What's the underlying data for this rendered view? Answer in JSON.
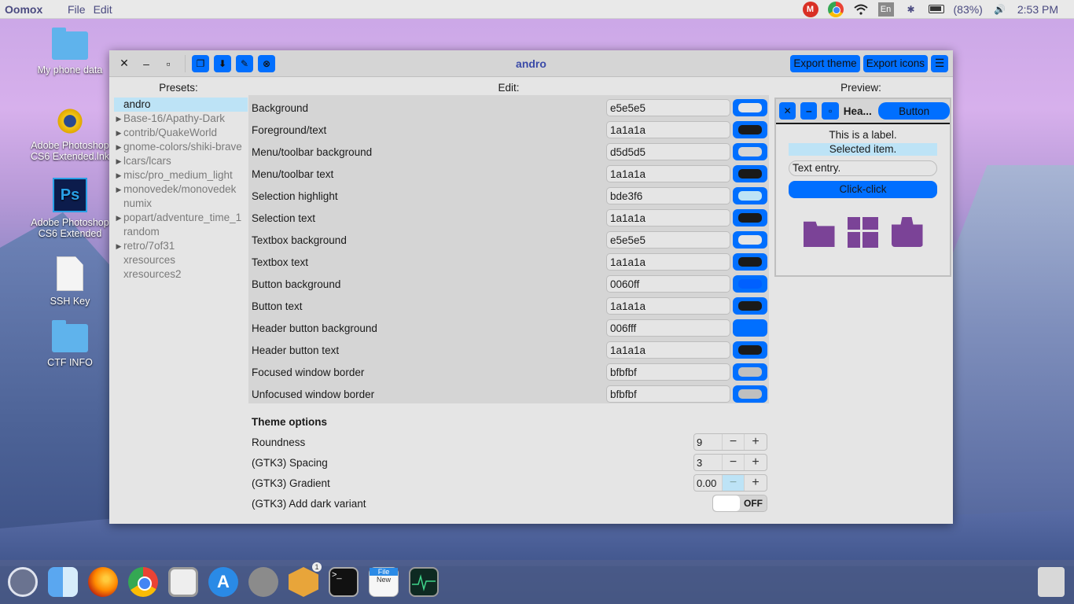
{
  "topbar": {
    "app_name": "Oomox",
    "menu": [
      "File",
      "Edit"
    ],
    "battery": "(83%)",
    "time": "2:53 PM",
    "lang": "En"
  },
  "desktop_icons": [
    {
      "label": "My phone data",
      "icon": "folder-icon"
    },
    {
      "label": "Adobe Photoshop CS6 Extended.lnk",
      "icon": "photoshop-shortcut-icon"
    },
    {
      "label": "Adobe Photoshop CS6 Extended",
      "icon": "photoshop-icon"
    },
    {
      "label": "SSH Key",
      "icon": "file-icon"
    },
    {
      "label": "CTF INFO",
      "icon": "folder-icon"
    }
  ],
  "window": {
    "title": "andro",
    "export_theme": "Export theme",
    "export_icons": "Export icons"
  },
  "presets": {
    "title": "Presets:",
    "items": [
      {
        "label": "andro",
        "expandable": false,
        "selected": true
      },
      {
        "label": "Base-16/Apathy-Dark",
        "expandable": true
      },
      {
        "label": "contrib/QuakeWorld",
        "expandable": true
      },
      {
        "label": "gnome-colors/shiki-brave",
        "expandable": true
      },
      {
        "label": "lcars/lcars",
        "expandable": true
      },
      {
        "label": "misc/pro_medium_light",
        "expandable": true
      },
      {
        "label": "monovedek/monovedek",
        "expandable": true
      },
      {
        "label": "numix",
        "expandable": false
      },
      {
        "label": "popart/adventure_time_1",
        "expandable": true
      },
      {
        "label": "random",
        "expandable": false
      },
      {
        "label": "retro/7of31",
        "expandable": true
      },
      {
        "label": "xresources",
        "expandable": false
      },
      {
        "label": "xresources2",
        "expandable": false
      }
    ]
  },
  "edit": {
    "title": "Edit:",
    "colors": [
      {
        "label": "Background",
        "value": "e5e5e5",
        "color": "#e5e5e5"
      },
      {
        "label": "Foreground/text",
        "value": "1a1a1a",
        "color": "#1a1a1a"
      },
      {
        "label": "Menu/toolbar background",
        "value": "d5d5d5",
        "color": "#d5d5d5"
      },
      {
        "label": "Menu/toolbar text",
        "value": "1a1a1a",
        "color": "#1a1a1a"
      },
      {
        "label": "Selection highlight",
        "value": "bde3f6",
        "color": "#bde3f6"
      },
      {
        "label": "Selection text",
        "value": "1a1a1a",
        "color": "#1a1a1a"
      },
      {
        "label": "Textbox background",
        "value": "e5e5e5",
        "color": "#e5e5e5"
      },
      {
        "label": "Textbox text",
        "value": "1a1a1a",
        "color": "#1a1a1a"
      },
      {
        "label": "Button background",
        "value": "0060ff",
        "color": "#0060ff"
      },
      {
        "label": "Button text",
        "value": "1a1a1a",
        "color": "#1a1a1a"
      },
      {
        "label": "Header button background",
        "value": "006fff",
        "color": "#006fff"
      },
      {
        "label": "Header button text",
        "value": "1a1a1a",
        "color": "#1a1a1a"
      },
      {
        "label": "Focused window border",
        "value": "bfbfbf",
        "color": "#bfbfbf"
      },
      {
        "label": "Unfocused window border",
        "value": "bfbfbf",
        "color": "#bfbfbf"
      }
    ],
    "theme_options_title": "Theme options",
    "options": {
      "roundness": {
        "label": "Roundness",
        "value": "9"
      },
      "spacing": {
        "label": "(GTK3) Spacing",
        "value": "3"
      },
      "gradient": {
        "label": "(GTK3) Gradient",
        "value": "0.00"
      },
      "dark_variant": {
        "label": "(GTK3) Add dark variant",
        "state": "OFF"
      }
    }
  },
  "preview": {
    "title": "Preview:",
    "header_title": "Hea...",
    "button": "Button",
    "label": "This is a label.",
    "selected": "Selected item.",
    "entry": "Text entry.",
    "click": "Click-click",
    "icons": [
      "folder-home-icon",
      "grid-apps-icon",
      "app-store-icon"
    ]
  },
  "dock": {
    "items": [
      "ubuntu-icon",
      "finder-icon",
      "firefox-icon",
      "chrome-icon",
      "preview-icon",
      "app-store-icon",
      "system-settings-icon",
      "package-icon",
      "terminal-icon",
      "files-icon",
      "system-monitor-icon"
    ],
    "package_badge": "1",
    "files_label": "File",
    "files_sub": "New",
    "trash": "trash-icon"
  },
  "colors": {
    "accent": "#006fff",
    "selection": "#bde3f6",
    "title": "#3a4aa8",
    "preview_icon": "#7b4397"
  }
}
